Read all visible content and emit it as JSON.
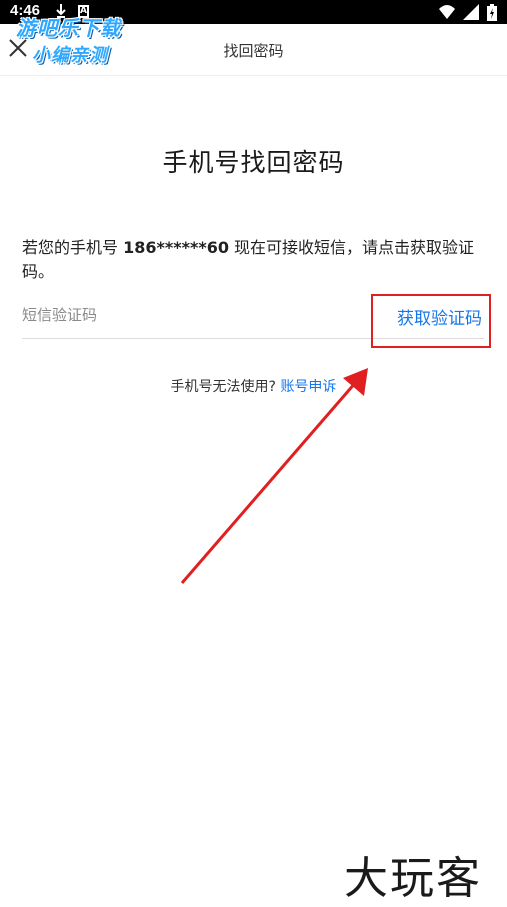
{
  "status_bar": {
    "time": "4:46"
  },
  "watermark": {
    "line1": "游吧乐下载",
    "line2": "小编亲测"
  },
  "top_bar": {
    "title": "找回密码",
    "close_icon": "close-icon"
  },
  "main": {
    "title": "手机号找回密码",
    "info_prefix": "若您的手机号 ",
    "phone": "186******60",
    "info_suffix": " 现在可接收短信，请点击获取验证码。",
    "code_placeholder": "短信验证码",
    "code_value": "",
    "get_code_label": "获取验证码",
    "help_text": "手机号无法使用? ",
    "appeal_label": "账号申诉"
  },
  "annotation": {
    "box_color": "#e02020",
    "arrow_color": "#e02020"
  },
  "corner_logo": {
    "text": "大玩客"
  },
  "colors": {
    "accent": "#1677e8",
    "background": "#ffffff"
  }
}
